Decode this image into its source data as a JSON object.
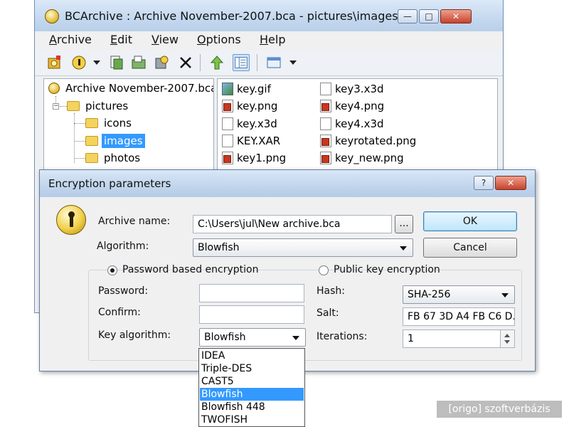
{
  "window": {
    "title": "BCArchive : Archive November-2007.bca - pictures\\images",
    "controls": {
      "minimize": "—",
      "maximize": "□",
      "close": "✕"
    }
  },
  "menu": [
    {
      "label": "Archive",
      "accel": "A",
      "rest": "rchive"
    },
    {
      "label": "Edit",
      "accel": "E",
      "rest": "dit"
    },
    {
      "label": "View",
      "accel": "V",
      "rest": "iew"
    },
    {
      "label": "Options",
      "accel": "O",
      "rest": "ptions"
    },
    {
      "label": "Help",
      "accel": "H",
      "rest": "elp"
    }
  ],
  "toolbar": {
    "icons": [
      "new-archive-icon",
      "open-archive-icon",
      "add-files-icon",
      "extract-icon",
      "encrypt-icon",
      "delete-icon",
      "up-folder-icon",
      "tree-view-icon",
      "view-mode-icon"
    ]
  },
  "tree": {
    "root": "Archive November-2007.bca",
    "folder": "pictures",
    "children": [
      "icons",
      "images",
      "photos"
    ],
    "selected": "images"
  },
  "files": [
    {
      "name": "key.gif",
      "type": "img"
    },
    {
      "name": "key.png",
      "type": "png"
    },
    {
      "name": "key.x3d",
      "type": "doc"
    },
    {
      "name": "KEY.XAR",
      "type": "doc"
    },
    {
      "name": "key1.png",
      "type": "png"
    },
    {
      "name": "key3.x3d",
      "type": "doc"
    },
    {
      "name": "key4.png",
      "type": "png"
    },
    {
      "name": "key4.x3d",
      "type": "doc"
    },
    {
      "name": "keyrotated.png",
      "type": "png"
    },
    {
      "name": "key_new.png",
      "type": "png"
    }
  ],
  "dialog": {
    "title": "Encryption parameters",
    "help_btn": "?",
    "close_btn": "✕",
    "archive_name_label": "Archive name:",
    "archive_name_value": "C:\\Users\\jul\\New archive.bca",
    "browse_label": "...",
    "algorithm_label": "Algorithm:",
    "algorithm_value": "Blowfish",
    "ok_label": "OK",
    "cancel_label": "Cancel",
    "password_radio_label": "Password based encryption",
    "public_key_radio_label": "Public key encryption",
    "password_label": "Password:",
    "password_value": "",
    "confirm_label": "Confirm:",
    "confirm_value": "",
    "key_algorithm_label": "Key algorithm:",
    "key_algorithm_value": "Blowfish",
    "hash_label": "Hash:",
    "hash_value": "SHA-256",
    "salt_label": "Salt:",
    "salt_value": "FB 67 3D A4 FB C6 D.",
    "iterations_label": "Iterations:",
    "iterations_value": "1",
    "key_algorithm_options": [
      "IDEA",
      "Triple-DES",
      "CAST5",
      "Blowfish",
      "Blowfish 448",
      "TWOFISH"
    ],
    "key_algorithm_selected": "Blowfish"
  },
  "watermark": "[origo] szoftverbázis"
}
